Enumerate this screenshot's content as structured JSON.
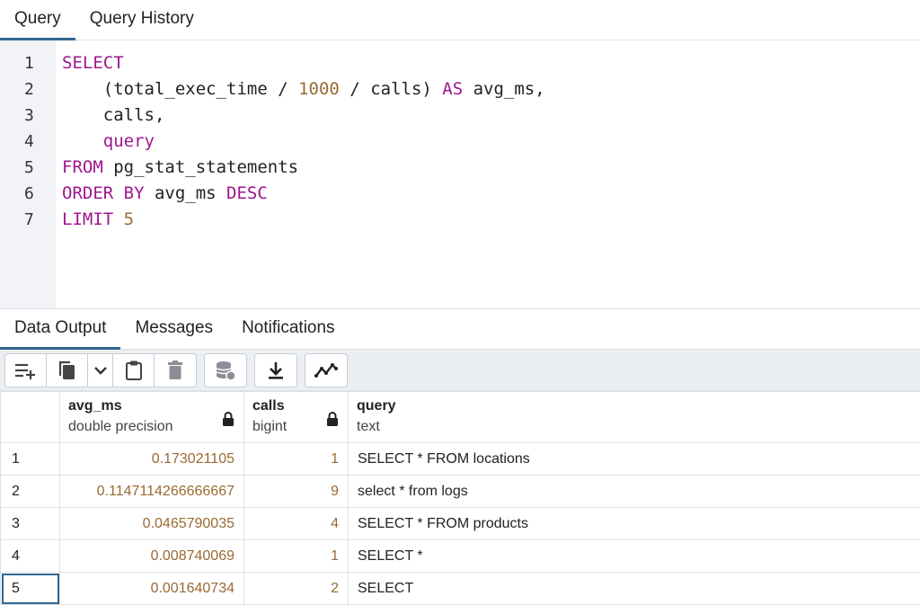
{
  "top_tabs": {
    "query": "Query",
    "history": "Query History"
  },
  "editor": {
    "line_numbers": [
      "1",
      "2",
      "3",
      "4",
      "5",
      "6",
      "7"
    ],
    "lines": [
      [
        {
          "t": "SELECT",
          "c": "kw"
        }
      ],
      [
        {
          "t": "    (total_exec_time / ",
          "c": ""
        },
        {
          "t": "1000",
          "c": "num"
        },
        {
          "t": " / calls) ",
          "c": ""
        },
        {
          "t": "AS",
          "c": "kw"
        },
        {
          "t": " avg_ms,",
          "c": ""
        }
      ],
      [
        {
          "t": "    calls,",
          "c": ""
        }
      ],
      [
        {
          "t": "    ",
          "c": ""
        },
        {
          "t": "query",
          "c": "kw"
        }
      ],
      [
        {
          "t": "FROM",
          "c": "kw"
        },
        {
          "t": " pg_stat_statements",
          "c": ""
        }
      ],
      [
        {
          "t": "ORDER BY",
          "c": "kw"
        },
        {
          "t": " avg_ms ",
          "c": ""
        },
        {
          "t": "DESC",
          "c": "kw"
        }
      ],
      [
        {
          "t": "LIMIT",
          "c": "kw"
        },
        {
          "t": " ",
          "c": ""
        },
        {
          "t": "5",
          "c": "num"
        }
      ]
    ]
  },
  "output_tabs": {
    "data": "Data Output",
    "messages": "Messages",
    "notifications": "Notifications"
  },
  "toolbar": {
    "icons": [
      "add-row-icon",
      "copy-icon",
      "chevron-down-icon",
      "paste-icon",
      "delete-icon",
      "save-data-icon",
      "download-icon",
      "graph-icon"
    ]
  },
  "grid": {
    "columns": [
      {
        "name": "avg_ms",
        "type": "double precision"
      },
      {
        "name": "calls",
        "type": "bigint"
      },
      {
        "name": "query",
        "type": "text"
      }
    ],
    "rows": [
      {
        "n": "1",
        "avg_ms": "0.173021105",
        "calls": "1",
        "query": "SELECT * FROM locations"
      },
      {
        "n": "2",
        "avg_ms": "0.1147114266666667",
        "calls": "9",
        "query": "select * from logs"
      },
      {
        "n": "3",
        "avg_ms": "0.0465790035",
        "calls": "4",
        "query": "SELECT * FROM products"
      },
      {
        "n": "4",
        "avg_ms": "0.008740069",
        "calls": "1",
        "query": "SELECT *"
      },
      {
        "n": "5",
        "avg_ms": "0.001640734",
        "calls": "2",
        "query": "SELECT"
      }
    ]
  },
  "colors": {
    "accent": "#326690",
    "keyword": "#a0168e",
    "number": "#9a6a33"
  }
}
